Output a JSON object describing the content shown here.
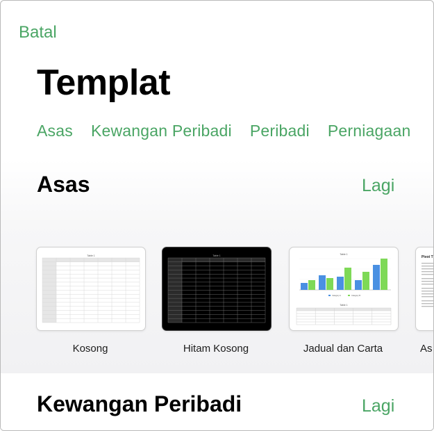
{
  "header": {
    "cancel_label": "Batal",
    "title": "Templat"
  },
  "tabs": [
    {
      "label": "Asas"
    },
    {
      "label": "Kewangan Peribadi"
    },
    {
      "label": "Peribadi"
    },
    {
      "label": "Perniagaan"
    }
  ],
  "sections": [
    {
      "title": "Asas",
      "more_label": "Lagi"
    },
    {
      "title": "Kewangan Peribadi",
      "more_label": "Lagi"
    }
  ],
  "templates": [
    {
      "label": "Kosong",
      "sheet_title": "Table 1"
    },
    {
      "label": "Hitam Kosong",
      "sheet_title": "Table 1"
    },
    {
      "label": "Jadual dan Carta",
      "chart_title": "Table 1",
      "table_title": "Table 1",
      "legend": [
        "Category A",
        "Category B"
      ],
      "colors": {
        "a": "#4a90e2",
        "b": "#7ed957"
      }
    },
    {
      "label": "As",
      "doc_title": "Pivot T"
    }
  ]
}
